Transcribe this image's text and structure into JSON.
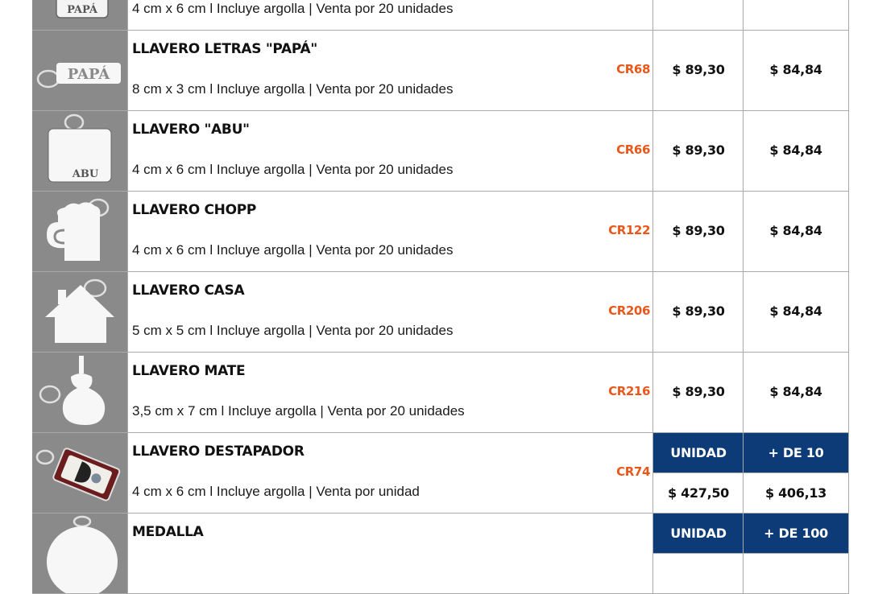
{
  "products": [
    {
      "title": "",
      "spec": "4 cm x 6 cm l Incluye argolla |  Venta por 20 unidades",
      "code": "",
      "price_unit": "",
      "price_bulk": "",
      "thumb_label": "PAPÁ",
      "icon": "keychain-papa-tag-icon"
    },
    {
      "title": "LLAVERO LETRAS \"PAPÁ\"",
      "spec": "8 cm x 3 cm l Incluye argolla | Venta por 20 unidades",
      "code": "CR68",
      "price_unit": "$ 89,30",
      "price_bulk": "$ 84,84",
      "thumb_label": "PAPÁ",
      "icon": "keychain-letters-icon"
    },
    {
      "title": "LLAVERO \"ABU\"",
      "spec": "4 cm x 6 cm l Incluye argolla | Venta por 20 unidades",
      "code": "CR66",
      "price_unit": "$ 89,30",
      "price_bulk": "$ 84,84",
      "thumb_label": "ABU",
      "icon": "keychain-abu-icon"
    },
    {
      "title": "LLAVERO CHOPP",
      "spec": "4 cm x 6 cm l Incluye argolla | Venta por 20 unidades",
      "code": "CR122",
      "price_unit": "$ 89,30",
      "price_bulk": "$ 84,84",
      "thumb_label": "",
      "icon": "keychain-beer-mug-icon"
    },
    {
      "title": "LLAVERO CASA",
      "spec": "5 cm x 5 cm l Incluye argolla | Venta por 20 unidades",
      "code": "CR206",
      "price_unit": "$ 89,30",
      "price_bulk": "$ 84,84",
      "thumb_label": "",
      "icon": "keychain-house-icon"
    },
    {
      "title": "LLAVERO MATE",
      "spec": "3,5 cm x 7 cm l Incluye argolla | Venta por 20 unidades",
      "code": "CR216",
      "price_unit": "$ 89,30",
      "price_bulk": "$ 84,84",
      "thumb_label": "",
      "icon": "keychain-mate-icon"
    },
    {
      "title": "LLAVERO DESTAPADOR",
      "spec": "4 cm x 6 cm l Incluye argolla | Venta por unidad",
      "code": "CR74",
      "header_unit": "UNIDAD",
      "header_bulk": "+ DE 10",
      "price_unit": "$ 427,50",
      "price_bulk": "$ 406,13",
      "thumb_label": "",
      "icon": "bottle-opener-keychain-icon"
    },
    {
      "title": "MEDALLA",
      "spec": "",
      "code": "",
      "header_unit": "UNIDAD",
      "header_bulk": "+ DE 100",
      "price_unit": "",
      "price_bulk": "",
      "thumb_label": "",
      "icon": "medal-icon"
    }
  ],
  "colors": {
    "code": "#e8581c",
    "header_bg": "#0d3b78",
    "thumb_bg": "#8a8a8a"
  }
}
